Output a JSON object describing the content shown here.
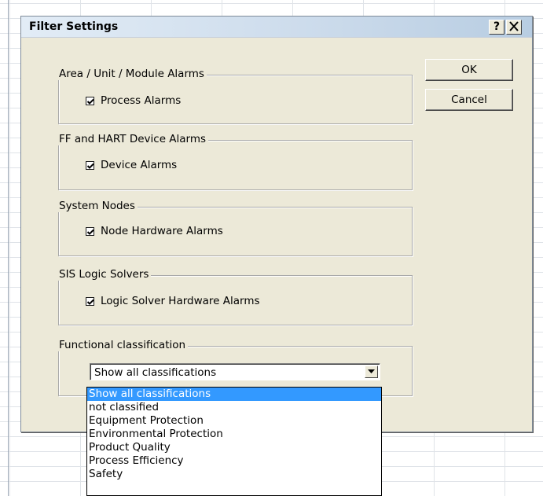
{
  "dialog": {
    "title": "Filter Settings",
    "help_label": "?",
    "close_label": "✕",
    "ok_label": "OK",
    "cancel_label": "Cancel"
  },
  "groups": [
    {
      "label": "Area / Unit / Module Alarms",
      "checkbox_label": "Process Alarms",
      "checked": true
    },
    {
      "label": "FF and HART Device Alarms",
      "checkbox_label": "Device Alarms",
      "checked": true
    },
    {
      "label": "System Nodes",
      "checkbox_label": "Node Hardware Alarms",
      "checked": true
    },
    {
      "label": "SIS Logic Solvers",
      "checkbox_label": "Logic Solver Hardware Alarms",
      "checked": true
    }
  ],
  "functional": {
    "label": "Functional classification",
    "selected": "Show all classifications",
    "options": [
      "Show all classifications",
      "not classified",
      "Equipment Protection",
      "Environmental Protection",
      "Product Quality",
      "Process Efficiency",
      "Safety"
    ]
  },
  "colors": {
    "dialog_bg": "#ece9d8",
    "highlight": "#3399ff"
  }
}
